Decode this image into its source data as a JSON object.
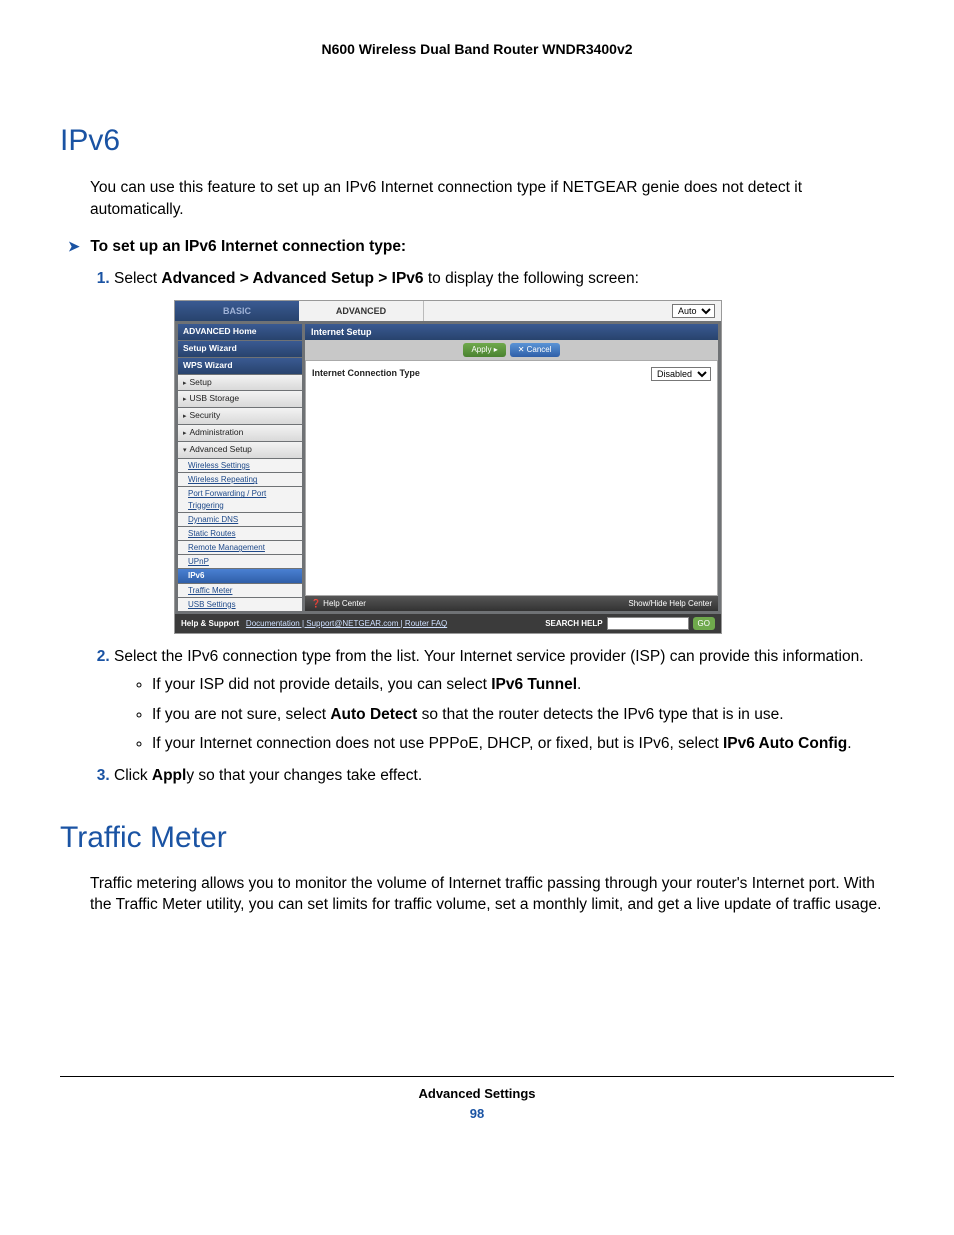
{
  "header": {
    "title": "N600 Wireless Dual Band Router WNDR3400v2"
  },
  "section1": {
    "heading": "IPv6",
    "intro": "You can use this feature to set up an IPv6 Internet connection type if NETGEAR genie does not detect it automatically.",
    "subhead": "To set up an IPv6 Internet connection type:",
    "step1_pre": "Select ",
    "step1_bold": "Advanced > Advanced Setup > IPv6",
    "step1_post": " to display the following screen:",
    "step2": "Select the IPv6 connection type from the list. Your Internet service provider (ISP) can provide this information.",
    "bullet1_pre": "If your ISP did not provide details, you can select ",
    "bullet1_bold": "IPv6 Tunnel",
    "bullet1_post": ".",
    "bullet2_pre": "If you are not sure, select ",
    "bullet2_bold": "Auto Detect",
    "bullet2_post": " so that the router detects the IPv6 type that is in use.",
    "bullet3_pre": "If your Internet connection does not use PPPoE, DHCP, or fixed, but is IPv6, select ",
    "bullet3_bold": "IPv6 Auto Config",
    "bullet3_post": ".",
    "step3_pre": "Click ",
    "step3_bold": "Appl",
    "step3_post": "y so that your changes take effect."
  },
  "shot": {
    "tab_basic": "BASIC",
    "tab_advanced": "ADVANCED",
    "top_dd": "Auto",
    "side": {
      "home": "ADVANCED Home",
      "wizard": "Setup Wizard",
      "wps": "WPS Wizard",
      "setup": "Setup",
      "usb": "USB Storage",
      "security": "Security",
      "admin": "Administration",
      "advsetup": "Advanced Setup",
      "subs": [
        "Wireless Settings",
        "Wireless Repeating",
        "Port Forwarding / Port Triggering",
        "Dynamic DNS",
        "Static Routes",
        "Remote Management",
        "UPnP",
        "IPv6",
        "Traffic Meter",
        "USB Settings"
      ]
    },
    "main": {
      "title": "Internet Setup",
      "apply": "Apply ▸",
      "cancel": "✕ Cancel",
      "rowlabel": "Internet Connection Type",
      "rowvalue": "Disabled"
    },
    "help": {
      "left": "❓ Help Center",
      "right": "Show/Hide Help Center"
    },
    "foot": {
      "label": "Help & Support",
      "links": "Documentation | Support@NETGEAR.com | Router FAQ",
      "search": "SEARCH HELP",
      "go": "GO"
    }
  },
  "section2": {
    "heading": "Traffic Meter",
    "body": "Traffic metering allows you to monitor the volume of Internet traffic passing through your router's Internet port. With the Traffic Meter utility, you can set limits for traffic volume, set a monthly limit, and get a live update of traffic usage."
  },
  "footer": {
    "section": "Advanced Settings",
    "page": "98"
  }
}
